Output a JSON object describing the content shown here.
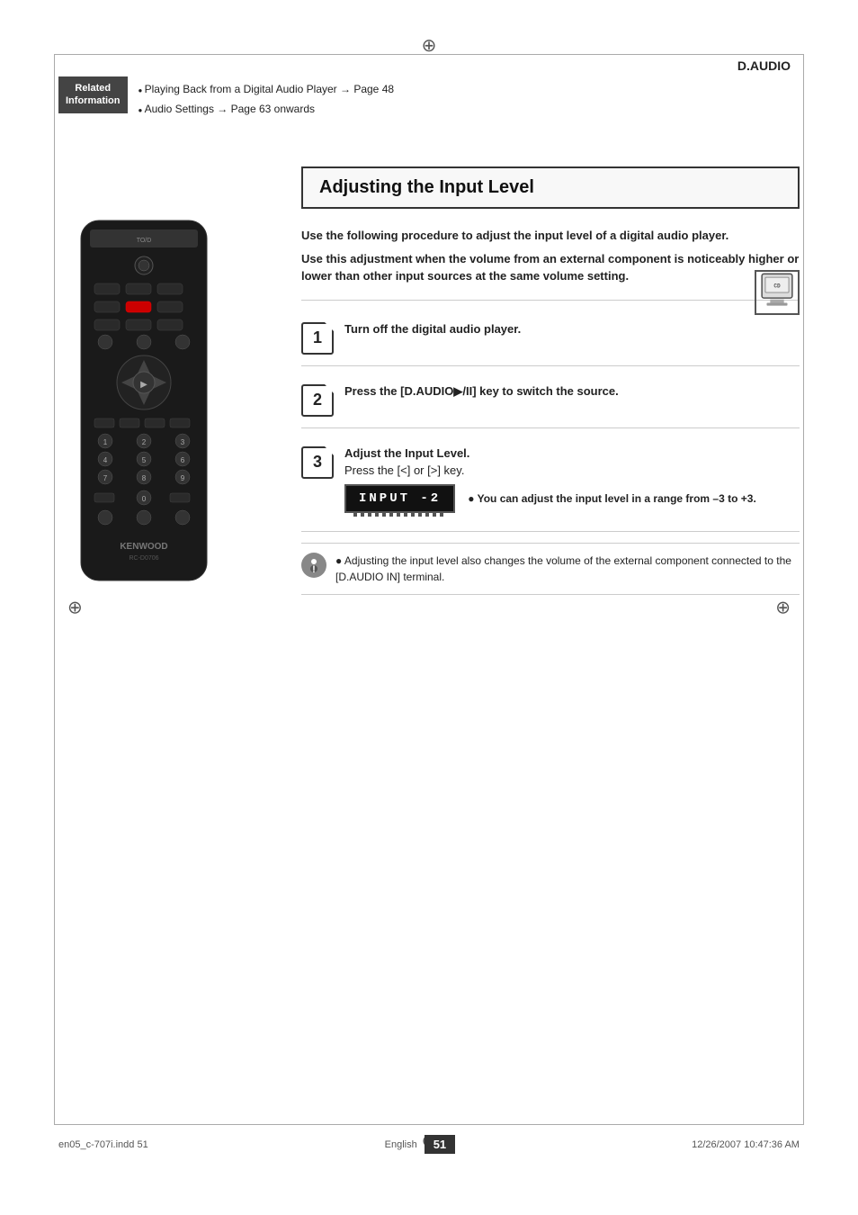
{
  "page": {
    "crosshair_symbol": "⊕",
    "daudio_label": "D.AUDIO"
  },
  "related_info": {
    "badge_line1": "Related",
    "badge_line2": "Information",
    "link1": "Playing Back from a Digital Audio Player → Page 48",
    "link2": "Audio Settings → Page 63 onwards"
  },
  "section": {
    "title": "Adjusting the Input Level",
    "intro1": "Use the following procedure to adjust the input level of a digital audio player.",
    "intro2": "Use this adjustment when the volume from an external component is noticeably higher or lower than other input sources at the same volume setting."
  },
  "steps": [
    {
      "number": "1",
      "instruction": "Turn off the digital audio player."
    },
    {
      "number": "2",
      "instruction": "Press the [D.AUDIO▶/II] key to switch the source."
    },
    {
      "number": "3",
      "instruction": "Adjust the Input Level.",
      "sub": "Press the [<] or [>] key."
    }
  ],
  "input_display": {
    "text": "INPUT   -2",
    "note": "You can adjust the input level in a range\nfrom –3 to +3."
  },
  "note": {
    "text": "Adjusting the input level also changes the volume of the external component connected to the [D.AUDIO IN] terminal."
  },
  "footer": {
    "left_text": "en05_c-707i.indd  51",
    "language": "English",
    "page_number": "51",
    "date": "12/26/2007  10:47:36 AM"
  }
}
